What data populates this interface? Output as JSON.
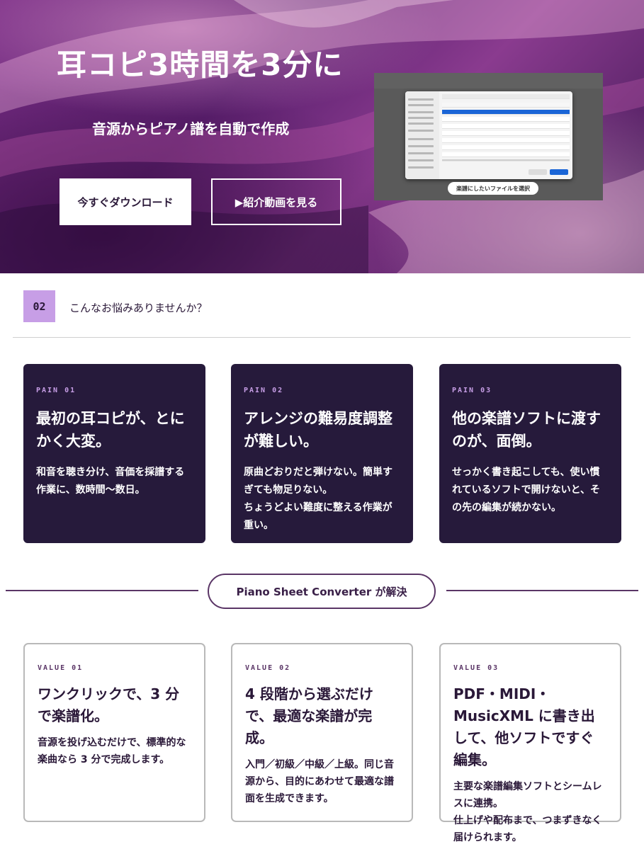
{
  "hero": {
    "title": "耳コピ3時間を3分に",
    "subtitle": "音源からピアノ譜を自動で作成",
    "download_label": "今すぐダウンロード",
    "video_label": "▶紹介動画を見る",
    "screenshot_caption": "楽譜にしたいファイルを選択"
  },
  "section": {
    "number": "02",
    "title": "こんなお悩みありませんか？"
  },
  "pains": [
    {
      "tag": "PAIN 01",
      "heading": "最初の耳コピが、とにかく大変。",
      "body": "和音を聴き分け、音価を採譜する作業に、数時間〜数日。"
    },
    {
      "tag": "PAIN 02",
      "heading": "アレンジの難易度調整が難しい。",
      "body": "原曲どおりだと弾けない。簡単すぎても物足りない。\nちょうどよい難度に整える作業が重い。"
    },
    {
      "tag": "PAIN 03",
      "heading": "他の楽譜ソフトに渡すのが、面倒。",
      "body": "せっかく書き起こしても、使い慣れているソフトで開けないと、その先の編集が続かない。"
    }
  ],
  "solution_badge": "Piano Sheet Converter が解決",
  "values": [
    {
      "tag": "VALUE 01",
      "heading": "ワンクリックで、3 分で楽譜化。",
      "body": "音源を投げ込むだけで、標準的な楽曲なら 3 分で完成します。"
    },
    {
      "tag": "VALUE 02",
      "heading": "4 段階から選ぶだけで、最適な楽譜が完成。",
      "body": "入門／初級／中級／上級。同じ音源から、目的にあわせて最適な譜面を生成できます。"
    },
    {
      "tag": "VALUE 03",
      "heading": "PDF・MIDI・MusicXML に書き出して、他ソフトですぐ編集。",
      "body": "主要な楽譜編集ソフトとシームレスに連携。\n仕上げや配布まで、つまずきなく届けられます。"
    }
  ],
  "colors": {
    "card_dark": "#261a3b",
    "accent_lavender": "#c79ee6",
    "accent_plum": "#5a3566"
  }
}
